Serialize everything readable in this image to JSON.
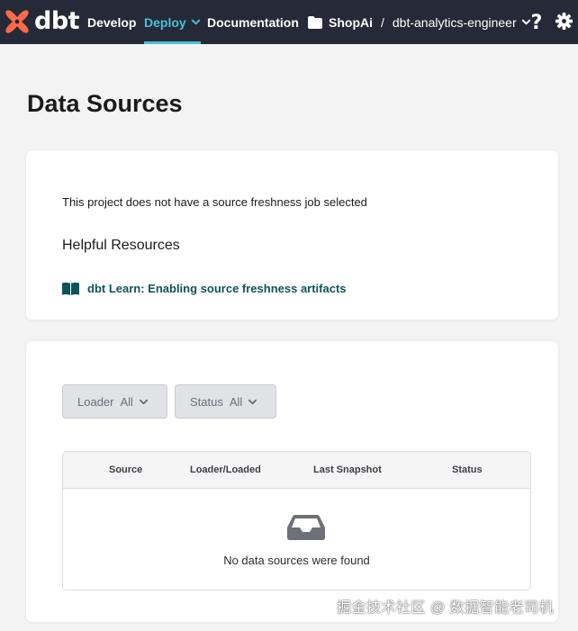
{
  "nav": {
    "logo_text": "dbt",
    "develop": "Develop",
    "deploy": "Deploy",
    "documentation": "Documentation",
    "project": "ShopAi",
    "separator": "/",
    "environment": "dbt-analytics-engineer",
    "help_symbol": "?",
    "accent_color": "#48c0d6",
    "brand_color": "#ff694a"
  },
  "page": {
    "title": "Data Sources"
  },
  "freshness_card": {
    "notice": "This project does not have a source freshness job selected",
    "resources_heading": "Helpful Resources",
    "learn_link": "dbt Learn: Enabling source freshness artifacts"
  },
  "filters": {
    "loader_label": "Loader",
    "loader_value": "All",
    "status_label": "Status",
    "status_value": "All"
  },
  "table": {
    "columns": [
      "Source",
      "Loader/Loaded",
      "Last Snapshot",
      "Status"
    ],
    "empty_message": "No data sources were found"
  },
  "watermark": "掘金技术社区 @ 数据智能老司机"
}
